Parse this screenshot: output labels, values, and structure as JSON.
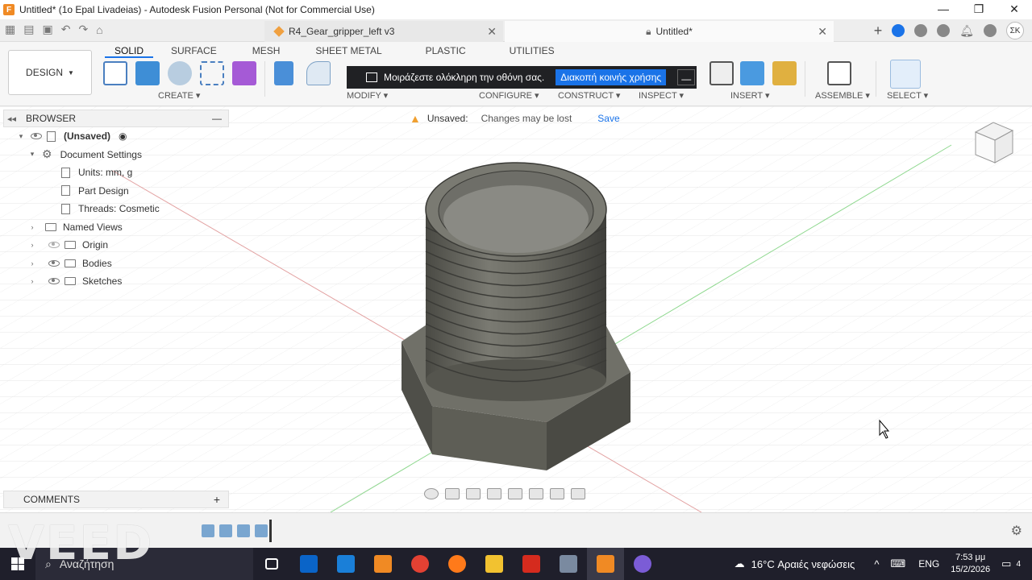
{
  "window": {
    "title": "Untitled* (1o Epal Livadeias) - Autodesk Fusion Personal (Not for Commercial Use)",
    "minimize": "—",
    "maximize": "❐",
    "close": "✕"
  },
  "tabs": [
    {
      "label": "R4_Gear_gripper_left v3"
    },
    {
      "label": "Untitled*"
    }
  ],
  "user_initials": "ΣΚ",
  "toolbar": {
    "design_label": "DESIGN",
    "workspace_tabs": [
      "SOLID",
      "SURFACE",
      "MESH",
      "SHEET METAL",
      "PLASTIC",
      "UTILITIES"
    ],
    "groups": [
      "CREATE",
      "MODIFY",
      "CONFIGURE",
      "CONSTRUCT",
      "INSPECT",
      "INSERT",
      "ASSEMBLE",
      "SELECT"
    ]
  },
  "share_banner": {
    "message": "Μοιράζεστε ολόκληρη την οθόνη σας.",
    "stop_label": "Διακοπή κοινής χρήσης",
    "minimize_label": "—"
  },
  "browser": {
    "title": "BROWSER",
    "root": "(Unsaved)",
    "document_settings": "Document Settings",
    "units": "Units: mm, g",
    "part_design": "Part Design",
    "threads": "Threads: Cosmetic",
    "named_views": "Named Views",
    "origin": "Origin",
    "bodies": "Bodies",
    "sketches": "Sketches"
  },
  "unsaved": {
    "label": "Unsaved:",
    "message": "Changes may be lost",
    "save": "Save"
  },
  "comments": {
    "title": "COMMENTS",
    "add": "+"
  },
  "watermark": "VEED",
  "taskbar": {
    "search_placeholder": "Αναζήτηση",
    "weather": "16°C  Αραιές νεφώσεις",
    "lang": "ENG",
    "time": "7:53 μμ",
    "date": "15/2/2026",
    "notifications": "4"
  },
  "colors": {
    "accent": "#1a73e8",
    "model": "#5a5a52",
    "banner": "#202124",
    "taskbar": "#1f1f2b"
  }
}
